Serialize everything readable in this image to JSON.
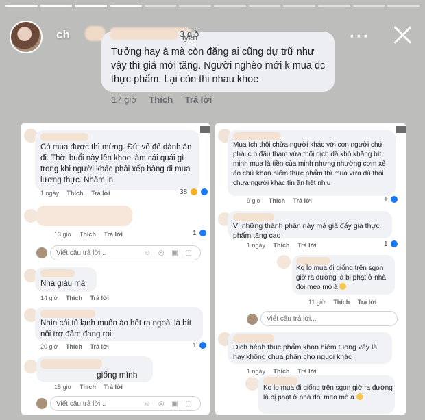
{
  "header": {
    "username": "ch",
    "username_tail": "iyên",
    "timestamp_fragment": "3 giờ"
  },
  "main_comment": {
    "text": "Tưởng hay à mà còn đăng ai cũng dự trữ như vậy thì giá mới tăng. Người nghèo mới k mua dc thực phẩm. Lại còn thi nhau khoe",
    "time": "17 giờ",
    "like": "Thích",
    "reply": "Trả lời"
  },
  "left": {
    "c1": {
      "text": "Có mua được thì mừng. Đút vô         để dành ăn đi. Thời buổi này lên khoe làm cái quái gì trong khi người khác phải xếp hàng đi mua lương thực. Nhãm ln.",
      "time": "1 ngày",
      "like": "Thích",
      "reply": "Trả lời",
      "count": "38"
    },
    "c2": {
      "time": "13 giờ",
      "like": "Thích",
      "reply": "Trả lời",
      "count": "1"
    },
    "reply_box_1": "Viết câu trả lời...",
    "c3": {
      "text": "Nhà giàu mà",
      "time": "14 giờ",
      "like": "Thích",
      "reply": "Trả lời"
    },
    "c4": {
      "text": "Nhìn cái tủ lạnh muốn ào hết ra ngoài là bít nội trợ đảm đang roi",
      "time": "20 giờ",
      "like": "Thích",
      "reply": "Trả lời",
      "count": "1"
    },
    "c5": {
      "text": "giống mình",
      "time": "15 giờ",
      "like": "Thích",
      "reply": "Trả lời"
    },
    "reply_box_2": "Viết câu trả lời..."
  },
  "right": {
    "c1": {
      "text": "Mua ích thôi chừa người khác với con người chứ phải c b đâu tham vừa thôi dịch dã khó khăng bít minh mua là tiền của minh nhưng nhường cơm xẻ áo chứ  khan hiếm thực phẩm thì mua vừa đủ thôi chưa người khác tín ăn hết nhiu",
      "time": "9 giờ",
      "like": "Thích",
      "reply": "Trả lời",
      "count": "1"
    },
    "c2": {
      "text": "Vì những thành phần này mà giá đẩy giá thực phẩm tăng cao",
      "time": "1 ngày",
      "like": "Thích",
      "reply": "Trả lời",
      "count": "1"
    },
    "c3": {
      "text": "Ko lo mua đi giống trên sgon giờ ra đường là bị phạt ở nhà đói meo mò à",
      "time": "11 giờ",
      "like": "Thích",
      "reply": "Trả lời"
    },
    "reply_box_1": "Viết câu trả lời...",
    "c4": {
      "text": "Dich bênh thuc phẩm khan hiêm tuong vây là hay.không chua phần cho nguoi khác",
      "time": "1 ngày",
      "like": "Thích",
      "reply": "Trả lời"
    },
    "c5": {
      "text": "Ko lo mua đi giống trên sgon giờ ra đường là bị phạt ở nhà đói meo mò à"
    }
  }
}
